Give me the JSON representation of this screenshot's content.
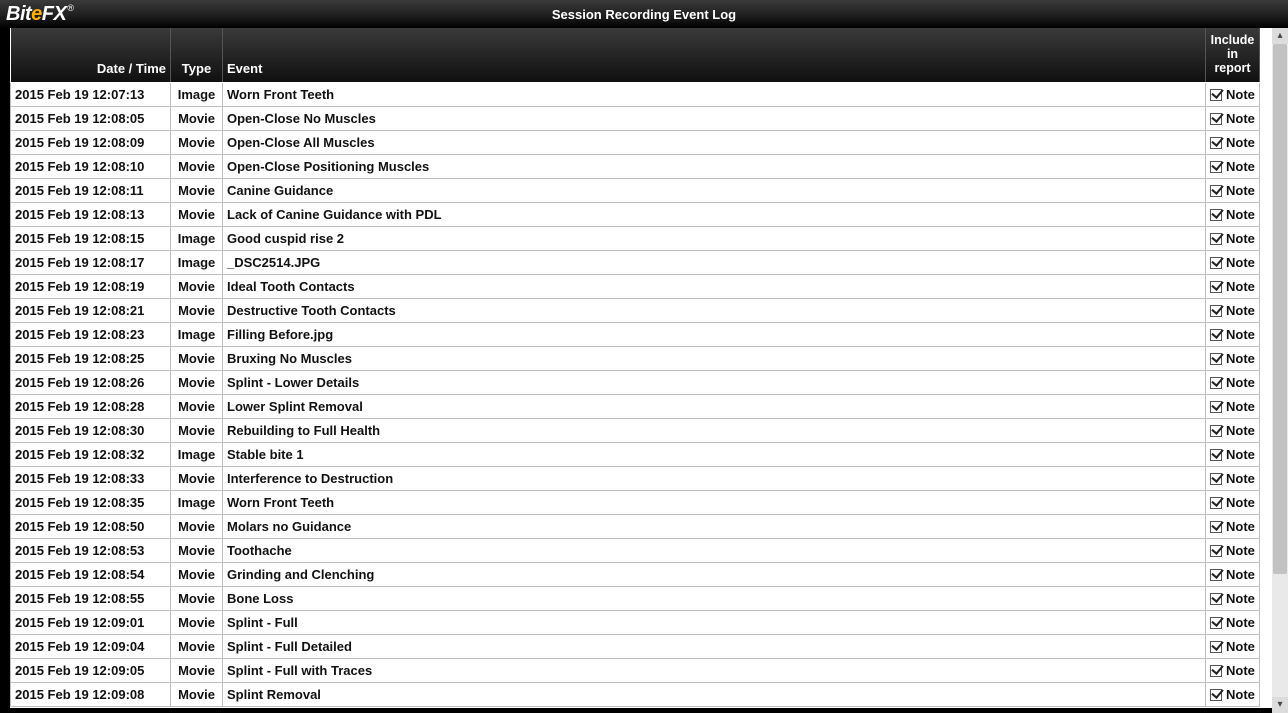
{
  "app": {
    "logo_pre": "Bit",
    "logo_accent": "e",
    "logo_post": "FX",
    "logo_reg": "®",
    "window_title": "Session Recording Event Log"
  },
  "columns": {
    "datetime": "Date / Time",
    "type": "Type",
    "event": "Event",
    "include": "Include in report"
  },
  "note_label": "Note",
  "rows": [
    {
      "dt": "2015 Feb 19 12:07:13",
      "type": "Image",
      "event": "Worn Front Teeth",
      "checked": true
    },
    {
      "dt": "2015 Feb 19 12:08:05",
      "type": "Movie",
      "event": "Open-Close No Muscles",
      "checked": true
    },
    {
      "dt": "2015 Feb 19 12:08:09",
      "type": "Movie",
      "event": "Open-Close All Muscles",
      "checked": true
    },
    {
      "dt": "2015 Feb 19 12:08:10",
      "type": "Movie",
      "event": "Open-Close Positioning Muscles",
      "checked": true
    },
    {
      "dt": "2015 Feb 19 12:08:11",
      "type": "Movie",
      "event": "Canine Guidance",
      "checked": true
    },
    {
      "dt": "2015 Feb 19 12:08:13",
      "type": "Movie",
      "event": "Lack of Canine Guidance with PDL",
      "checked": true
    },
    {
      "dt": "2015 Feb 19 12:08:15",
      "type": "Image",
      "event": "Good cuspid rise 2",
      "checked": true
    },
    {
      "dt": "2015 Feb 19 12:08:17",
      "type": "Image",
      "event": "_DSC2514.JPG",
      "checked": true
    },
    {
      "dt": "2015 Feb 19 12:08:19",
      "type": "Movie",
      "event": "Ideal Tooth Contacts",
      "checked": true
    },
    {
      "dt": "2015 Feb 19 12:08:21",
      "type": "Movie",
      "event": "Destructive Tooth Contacts",
      "checked": true
    },
    {
      "dt": "2015 Feb 19 12:08:23",
      "type": "Image",
      "event": "Filling Before.jpg",
      "checked": true
    },
    {
      "dt": "2015 Feb 19 12:08:25",
      "type": "Movie",
      "event": "Bruxing No Muscles",
      "checked": true
    },
    {
      "dt": "2015 Feb 19 12:08:26",
      "type": "Movie",
      "event": "Splint - Lower Details",
      "checked": true
    },
    {
      "dt": "2015 Feb 19 12:08:28",
      "type": "Movie",
      "event": "Lower Splint Removal",
      "checked": true
    },
    {
      "dt": "2015 Feb 19 12:08:30",
      "type": "Movie",
      "event": "Rebuilding to Full Health",
      "checked": true
    },
    {
      "dt": "2015 Feb 19 12:08:32",
      "type": "Image",
      "event": "Stable bite 1",
      "checked": true
    },
    {
      "dt": "2015 Feb 19 12:08:33",
      "type": "Movie",
      "event": "Interference to Destruction",
      "checked": true
    },
    {
      "dt": "2015 Feb 19 12:08:35",
      "type": "Image",
      "event": "Worn Front Teeth",
      "checked": true
    },
    {
      "dt": "2015 Feb 19 12:08:50",
      "type": "Movie",
      "event": "Molars no Guidance",
      "checked": true
    },
    {
      "dt": "2015 Feb 19 12:08:53",
      "type": "Movie",
      "event": "Toothache",
      "checked": true
    },
    {
      "dt": "2015 Feb 19 12:08:54",
      "type": "Movie",
      "event": "Grinding and Clenching",
      "checked": true
    },
    {
      "dt": "2015 Feb 19 12:08:55",
      "type": "Movie",
      "event": "Bone Loss",
      "checked": true
    },
    {
      "dt": "2015 Feb 19 12:09:01",
      "type": "Movie",
      "event": "Splint - Full",
      "checked": true
    },
    {
      "dt": "2015 Feb 19 12:09:04",
      "type": "Movie",
      "event": "Splint - Full Detailed",
      "checked": true
    },
    {
      "dt": "2015 Feb 19 12:09:05",
      "type": "Movie",
      "event": "Splint - Full with Traces",
      "checked": true
    },
    {
      "dt": "2015 Feb 19 12:09:08",
      "type": "Movie",
      "event": "Splint Removal",
      "checked": true
    }
  ]
}
